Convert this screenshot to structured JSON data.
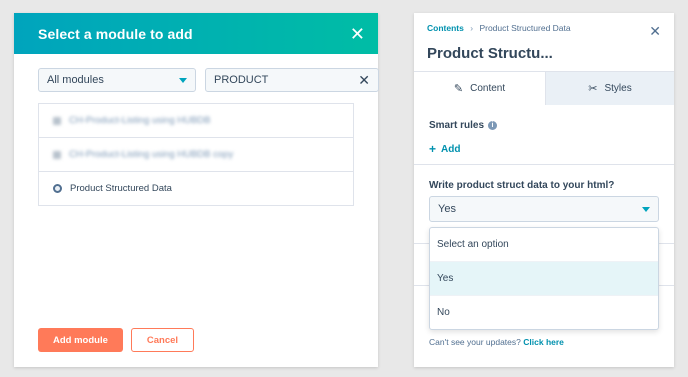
{
  "modal": {
    "title": "Select a module to add",
    "filter_select": "All modules",
    "search_value": "PRODUCT",
    "modules": [
      {
        "label": "CH-Product-Listing using HUBDB",
        "icon": "module-square-icon",
        "blurred": true
      },
      {
        "label": "CH-Product-Listing using HUBDB copy",
        "icon": "module-square-icon",
        "blurred": true
      },
      {
        "label": "Product Structured Data",
        "icon": "module-circle-icon",
        "blurred": false
      }
    ],
    "add_button": "Add module",
    "cancel_button": "Cancel"
  },
  "panel": {
    "breadcrumb": {
      "root": "Contents",
      "separator": "›",
      "current": "Product Structured Data"
    },
    "title": "Product Structu...",
    "tabs": {
      "content": "Content",
      "styles": "Styles"
    },
    "smart_rules_label": "Smart rules",
    "add_label": "Add",
    "question": "Write product struct data to your html?",
    "selected_value": "Yes",
    "options": [
      "Select an option",
      "Yes",
      "No"
    ],
    "highlighted_option": "Yes",
    "footer_text": "Can't see your updates?",
    "footer_link": "Click here"
  },
  "colors": {
    "header_gradient_start": "#00a4bd",
    "header_gradient_end": "#00bda5",
    "primary_button": "#ff7a59",
    "link": "#0091ae"
  }
}
